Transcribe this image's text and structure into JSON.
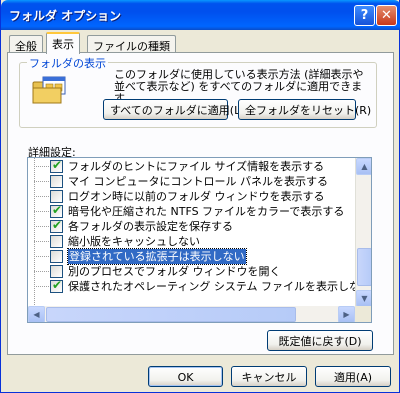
{
  "window": {
    "title": "フォルダ オプション",
    "help_glyph": "?",
    "close_glyph": "✕"
  },
  "tabs": [
    {
      "label": "全般",
      "active": false
    },
    {
      "label": "表示",
      "active": true
    },
    {
      "label": "ファイルの種類",
      "active": false
    }
  ],
  "folder_views": {
    "legend": "フォルダの表示",
    "description": "このフォルダに使用している表示方法 (詳細表示や並べて表示など) をすべてのフォルダに適用できます。",
    "apply_all_label": "すべてのフォルダに適用(L)",
    "reset_all_label": "全フォルダをリセット(R)",
    "icon": "folder-window-icon"
  },
  "advanced": {
    "label": "詳細設定:",
    "items": [
      {
        "label": "フォルダのヒントにファイル サイズ情報を表示する",
        "checked": true,
        "selected": false
      },
      {
        "label": "マイ コンピュータにコントロール パネルを表示する",
        "checked": false,
        "selected": false
      },
      {
        "label": "ログオン時に以前のフォルダ ウィンドウを表示する",
        "checked": false,
        "selected": false
      },
      {
        "label": "暗号化や圧縮された NTFS ファイルをカラーで表示する",
        "checked": true,
        "selected": false
      },
      {
        "label": "各フォルダの表示設定を保存する",
        "checked": true,
        "selected": false
      },
      {
        "label": "縮小版をキャッシュしない",
        "checked": false,
        "selected": false
      },
      {
        "label": "登録されている拡張子は表示しない",
        "checked": false,
        "selected": true
      },
      {
        "label": "別のプロセスでフォルダ ウィンドウを開く",
        "checked": false,
        "selected": false
      },
      {
        "label": "保護されたオペレーティング システム ファイルを表示しない (推奨)",
        "checked": true,
        "selected": false
      }
    ],
    "restore_defaults_label": "既定値に戻す(D)"
  },
  "footer": {
    "ok_label": "OK",
    "cancel_label": "キャンセル",
    "apply_label": "適用(A)"
  },
  "colors": {
    "title_bar": "#0054E3",
    "selection": "#316AC5",
    "check": "#21A121",
    "legend": "#0046D5"
  }
}
